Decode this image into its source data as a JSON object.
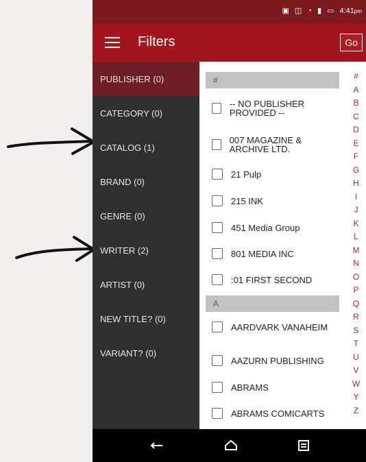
{
  "status": {
    "time": "4:41",
    "ampm": "pm"
  },
  "header": {
    "title": "Filters",
    "go_label": "Go"
  },
  "sidebar": {
    "items": [
      {
        "label": "PUBLISHER (0)"
      },
      {
        "label": "CATEGORY (0)"
      },
      {
        "label": "CATALOG (1)"
      },
      {
        "label": "BRAND (0)"
      },
      {
        "label": "GENRE (0)"
      },
      {
        "label": "WRITER (2)"
      },
      {
        "label": "ARTIST (0)"
      },
      {
        "label": "NEW TITLE? (0)"
      },
      {
        "label": "VARIANT? (0)"
      }
    ]
  },
  "list": {
    "sections": [
      {
        "header": "#"
      },
      {
        "header": "A"
      }
    ],
    "items": [
      {
        "label": "-- NO PUBLISHER PROVIDED --"
      },
      {
        "label": "007 MAGAZINE & ARCHIVE LTD."
      },
      {
        "label": "21 Pulp"
      },
      {
        "label": "215 INK"
      },
      {
        "label": "451 Media Group"
      },
      {
        "label": "801 MEDIA INC"
      },
      {
        "label": ":01 FIRST SECOND"
      },
      {
        "label": "AARDVARK VANAHEIM"
      },
      {
        "label": "AAZURN PUBLISHING"
      },
      {
        "label": "ABRAMS"
      },
      {
        "label": "ABRAMS COMICARTS"
      }
    ]
  },
  "alphabet": [
    "#",
    "A",
    "B",
    "C",
    "D",
    "E",
    "F",
    "G",
    "H",
    "I",
    "J",
    "K",
    "L",
    "M",
    "N",
    "O",
    "P",
    "Q",
    "R",
    "S",
    "T",
    "U",
    "V",
    "W",
    "Y",
    "Z"
  ],
  "colors": {
    "status_bar": "#7a1a1f",
    "app_bar": "#a3161d",
    "sidebar": "#2f2f2f",
    "active_item": "#6d1e23",
    "alphabet": "#b4232b",
    "page_background": "#f3eeee"
  },
  "icons": {
    "menu": "menu-icon",
    "back": "back-icon",
    "home": "home-icon",
    "recents": "recent-apps-icon"
  }
}
